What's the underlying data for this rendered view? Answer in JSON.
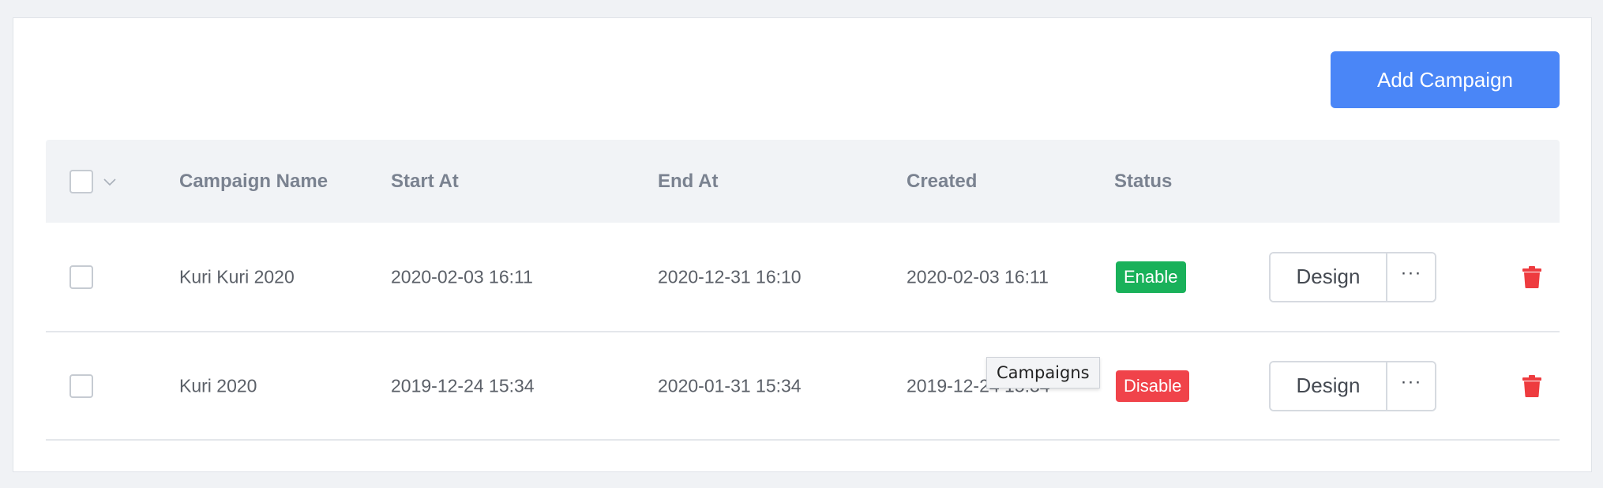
{
  "toolbar": {
    "add_label": "Add Campaign"
  },
  "table": {
    "headers": {
      "name": "Campaign Name",
      "start": "Start At",
      "end": "End At",
      "created": "Created",
      "status": "Status"
    },
    "rows": [
      {
        "name": "Kuri Kuri 2020",
        "start": "2020-02-03 16:11",
        "end": "2020-12-31 16:10",
        "created": "2020-02-03 16:11",
        "status": "Enable",
        "design_label": "Design",
        "more_label": "···"
      },
      {
        "name": "Kuri 2020",
        "start": "2019-12-24 15:34",
        "end": "2020-01-31 15:34",
        "created": "2019-12-24 15:34",
        "status": "Disable",
        "design_label": "Design",
        "more_label": "···"
      }
    ]
  },
  "tooltip": {
    "text": "Campaigns"
  },
  "colors": {
    "primary": "#4a86f7",
    "enable": "#19b15a",
    "disable": "#f0434a",
    "trash": "#ee3b3f"
  }
}
